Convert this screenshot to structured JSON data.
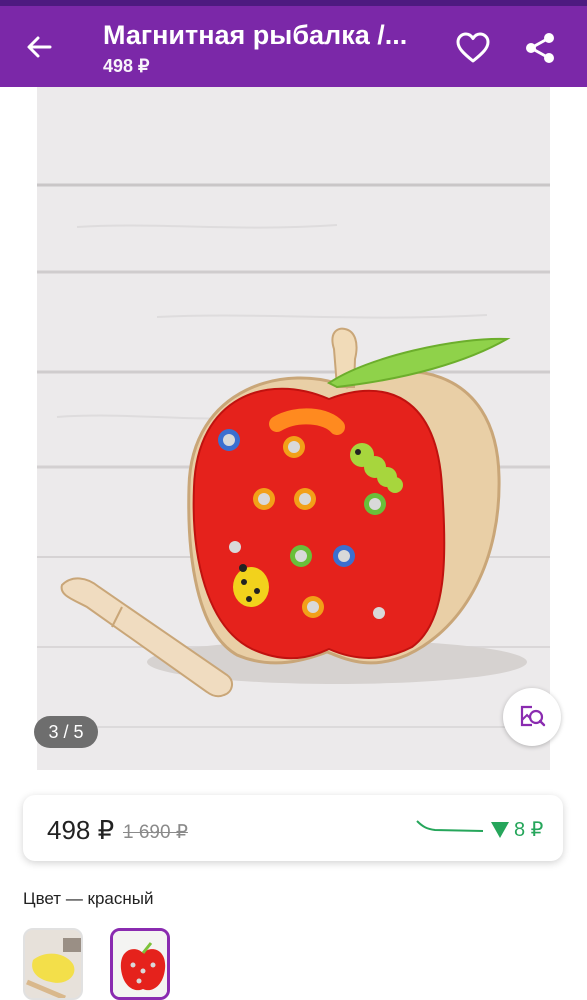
{
  "header": {
    "title": "Магнитная рыбалка /...",
    "price": "498 ₽",
    "icons": [
      "back-arrow-icon",
      "heart-icon",
      "share-icon"
    ],
    "bar_color": "#7b28a8"
  },
  "gallery": {
    "counter": "3 / 5",
    "current_index": 3,
    "total": 5,
    "zoom_icon": "image-search-icon"
  },
  "price_card": {
    "price": "498 ₽",
    "old_price": "1 690 ₽",
    "price_drop": "8 ₽",
    "drop_color": "#26a65b"
  },
  "color": {
    "label": "Цвет — красный",
    "selected_index": 1,
    "accent": "#8a2bb0"
  }
}
